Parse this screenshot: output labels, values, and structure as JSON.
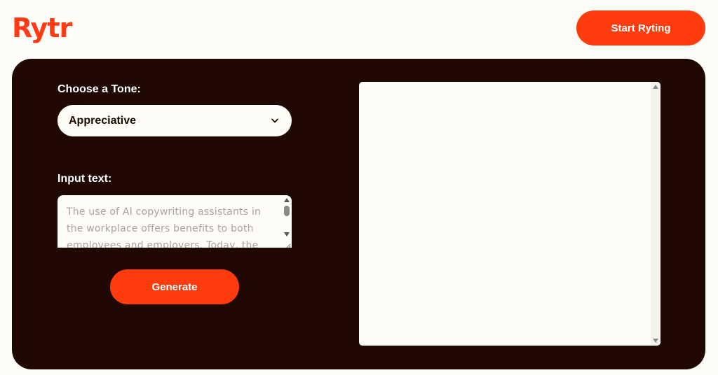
{
  "header": {
    "logo_text": "Rytr",
    "start_button_label": "Start Ryting"
  },
  "form": {
    "tone_label": "Choose a Tone:",
    "tone_selected": "Appreciative",
    "input_label": "Input text:",
    "input_placeholder": "The use of AI copywriting assistants in the workplace offers benefits to both employees and employers. Today, the",
    "generate_button_label": "Generate"
  },
  "output": {
    "text": ""
  },
  "colors": {
    "accent": "#ff3c0e",
    "panel_bg": "#200803",
    "page_bg": "#fdfcf7"
  },
  "icons": {
    "tone_dropdown": "chevron-down-icon"
  }
}
